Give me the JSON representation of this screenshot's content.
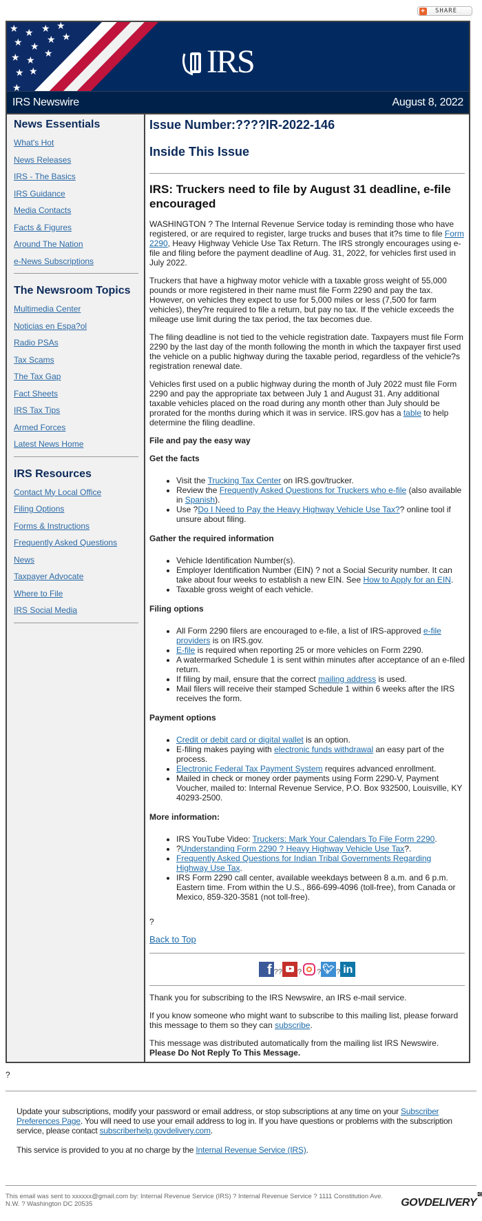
{
  "share": {
    "label": "SHARE"
  },
  "header": {
    "logo_text": "IRS",
    "newswire": "IRS Newswire",
    "date": "August 8, 2022"
  },
  "sidebar": {
    "sections": [
      {
        "title": "News Essentials",
        "items": [
          "What's Hot",
          "News Releases",
          "IRS - The Basics",
          "IRS Guidance",
          "Media Contacts",
          "Facts & Figures",
          "Around The Nation",
          "e-News Subscriptions"
        ]
      },
      {
        "title": "The Newsroom Topics",
        "items": [
          "Multimedia Center",
          "Noticias en Espa?ol",
          "Radio PSAs",
          "Tax Scams",
          "The Tax Gap",
          "Fact Sheets",
          "IRS Tax Tips",
          "Armed Forces",
          "Latest News Home"
        ]
      },
      {
        "title": "IRS Resources",
        "items": [
          "Contact My Local Office",
          "Filing Options",
          "Forms & Instructions",
          "Frequently Asked Questions",
          "News",
          "Taxpayer Advocate",
          "Where to File",
          "IRS Social Media"
        ]
      }
    ]
  },
  "main": {
    "issue": "Issue Number:????IR-2022-146",
    "inside": "Inside This Issue",
    "title": "IRS: Truckers need to file by August 31 deadline, e-file encouraged",
    "p1": {
      "a": "WASHINGTON ? The Internal Revenue Service today is reminding those who have registered, or are required to register, large trucks and buses that it?s time to file ",
      "link": "Form 2290",
      "b": ", Heavy Highway Vehicle Use Tax Return. The IRS strongly encourages using e-file and filing before the payment deadline of Aug. 31, 2022, for vehicles first used in July 2022."
    },
    "p2": "Truckers that have a highway motor vehicle with a taxable gross weight of 55,000 pounds or more registered in their name must file Form 2290 and pay the tax. However, on vehicles they expect to use for 5,000 miles or less (7,500 for farm vehicles), they?re required to file a return, but pay no tax. If the vehicle exceeds the mileage use limit during the tax period, the tax becomes due.",
    "p3": "The filing deadline is not tied to the vehicle registration date. Taxpayers must file Form 2290 by the last day of the month following the month in which the taxpayer first used the vehicle on a public highway during the taxable period, regardless of the vehicle?s registration renewal date.",
    "p4": {
      "a": "Vehicles first used on a public highway during the month of July 2022 must file Form 2290 and pay the appropriate tax between July 1 and August 31. Any additional taxable vehicles placed on the road during any month other than July should be prorated for the months during which it was in service. IRS.gov has a ",
      "link": "table",
      "b": " to help determine the filing deadline."
    },
    "h_easy": "File and pay the easy way",
    "h_facts": "Get the facts",
    "facts": [
      {
        "a": "Visit the ",
        "link": "Trucking Tax Center",
        "b": " on IRS.gov/trucker."
      },
      {
        "a": "Review the ",
        "link": "Frequently Asked Questions for Truckers who e-file",
        "b": " (also available in ",
        "link2": "Spanish",
        "c": ")."
      },
      {
        "a": "Use ?",
        "link": "Do I Need to Pay the Heavy Highway Vehicle Use Tax?",
        "b": "? online tool if unsure about filing."
      }
    ],
    "h_gather": "Gather the required information",
    "gather": [
      {
        "a": "Vehicle Identification Number(s)."
      },
      {
        "a": "Employer Identification Number (EIN) ? not a Social Security number. It can take about four weeks to establish a new EIN. See ",
        "link": "How to Apply for an EIN",
        "b": "."
      },
      {
        "a": "Taxable gross weight of each vehicle."
      }
    ],
    "h_filing": "Filing options",
    "filing": [
      {
        "a": "All Form 2290 filers are encouraged to e-file, a list of IRS-approved ",
        "link": "e-file providers",
        "b": " is on IRS.gov."
      },
      {
        "a": "",
        "link": "E-file",
        "b": " is required when reporting 25 or more vehicles on Form 2290."
      },
      {
        "a": "A watermarked Schedule 1 is sent within minutes after acceptance of an e-filed return."
      },
      {
        "a": "If filing by mail, ensure that the correct ",
        "link": "mailing address",
        "b": " is used."
      },
      {
        "a": "Mail filers will receive their stamped Schedule 1 within 6 weeks after the IRS receives the form."
      }
    ],
    "h_payment": "Payment options",
    "payment": [
      {
        "a": "",
        "link": "Credit or debit card or digital wallet",
        "b": " is an option."
      },
      {
        "a": "E-filing makes paying with ",
        "link": "electronic funds withdrawal",
        "b": " an easy part of the process."
      },
      {
        "a": "",
        "link": "Electronic Federal Tax Payment System",
        "b": " requires advanced enrollment."
      },
      {
        "a": "Mailed in check or money order payments using Form 2290-V, Payment Voucher, mailed to: Internal Revenue Service, P.O. Box 932500, Louisville, KY 40293-2500."
      }
    ],
    "h_more": "More information:",
    "more": [
      {
        "a": "IRS YouTube Video: ",
        "link": "Truckers: Mark Your Calendars To File Form 2290",
        "b": "."
      },
      {
        "a": "?",
        "link": "Understanding Form 2290 ? Heavy Highway Vehicle Use Tax",
        "b": "?."
      },
      {
        "a": "",
        "link": "Frequently Asked Questions for Indian Tribal Governments Regarding Highway Use Tax",
        "b": "."
      },
      {
        "a": "IRS Form 2290 call center, available weekdays between 8 a.m. and 6 p.m. Eastern time. From within the U.S., 866-699-4096 (toll-free), from Canada or Mexico, 859-320-3581 (not toll-free)."
      }
    ],
    "q": "?",
    "back_to_top": "Back to Top",
    "social": {
      "sep1": "??",
      "sep2": "?",
      "sep3": "?",
      "sep4": "?"
    },
    "thanks": "Thank you for subscribing to the IRS Newswire, an IRS e-mail service.",
    "forward": {
      "a": "If you know someone who might want to subscribe to this mailing list, please forward this message to them so they can ",
      "link": "subscribe",
      "b": "."
    },
    "auto": "This message was distributed automatically from the mailing list IRS Newswire.",
    "noreply": "Please Do Not Reply To This Message."
  },
  "post_q": "?",
  "footer": {
    "update": {
      "a": "Update your subscriptions, modify your password or email address, or stop subscriptions at any time on your ",
      "link": "Subscriber Preferences Page",
      "b": ". You will need to use your email address to log in. If you have questions or problems with the subscription service, please contact ",
      "link2": "subscriberhelp.govdelivery.com",
      "c": "."
    },
    "service": {
      "a": "This service is provided to you at no charge by the ",
      "link": "Internal Revenue Service (IRS)",
      "b": "."
    },
    "sent": "This email was sent to xxxxxx@gmail.com by: Internal Revenue Service (IRS) ? Internal Revenue Service ? 1111 Constitution Ave. N.W. ? Washington DC 20535",
    "brand": "GOVDELIVERY"
  }
}
